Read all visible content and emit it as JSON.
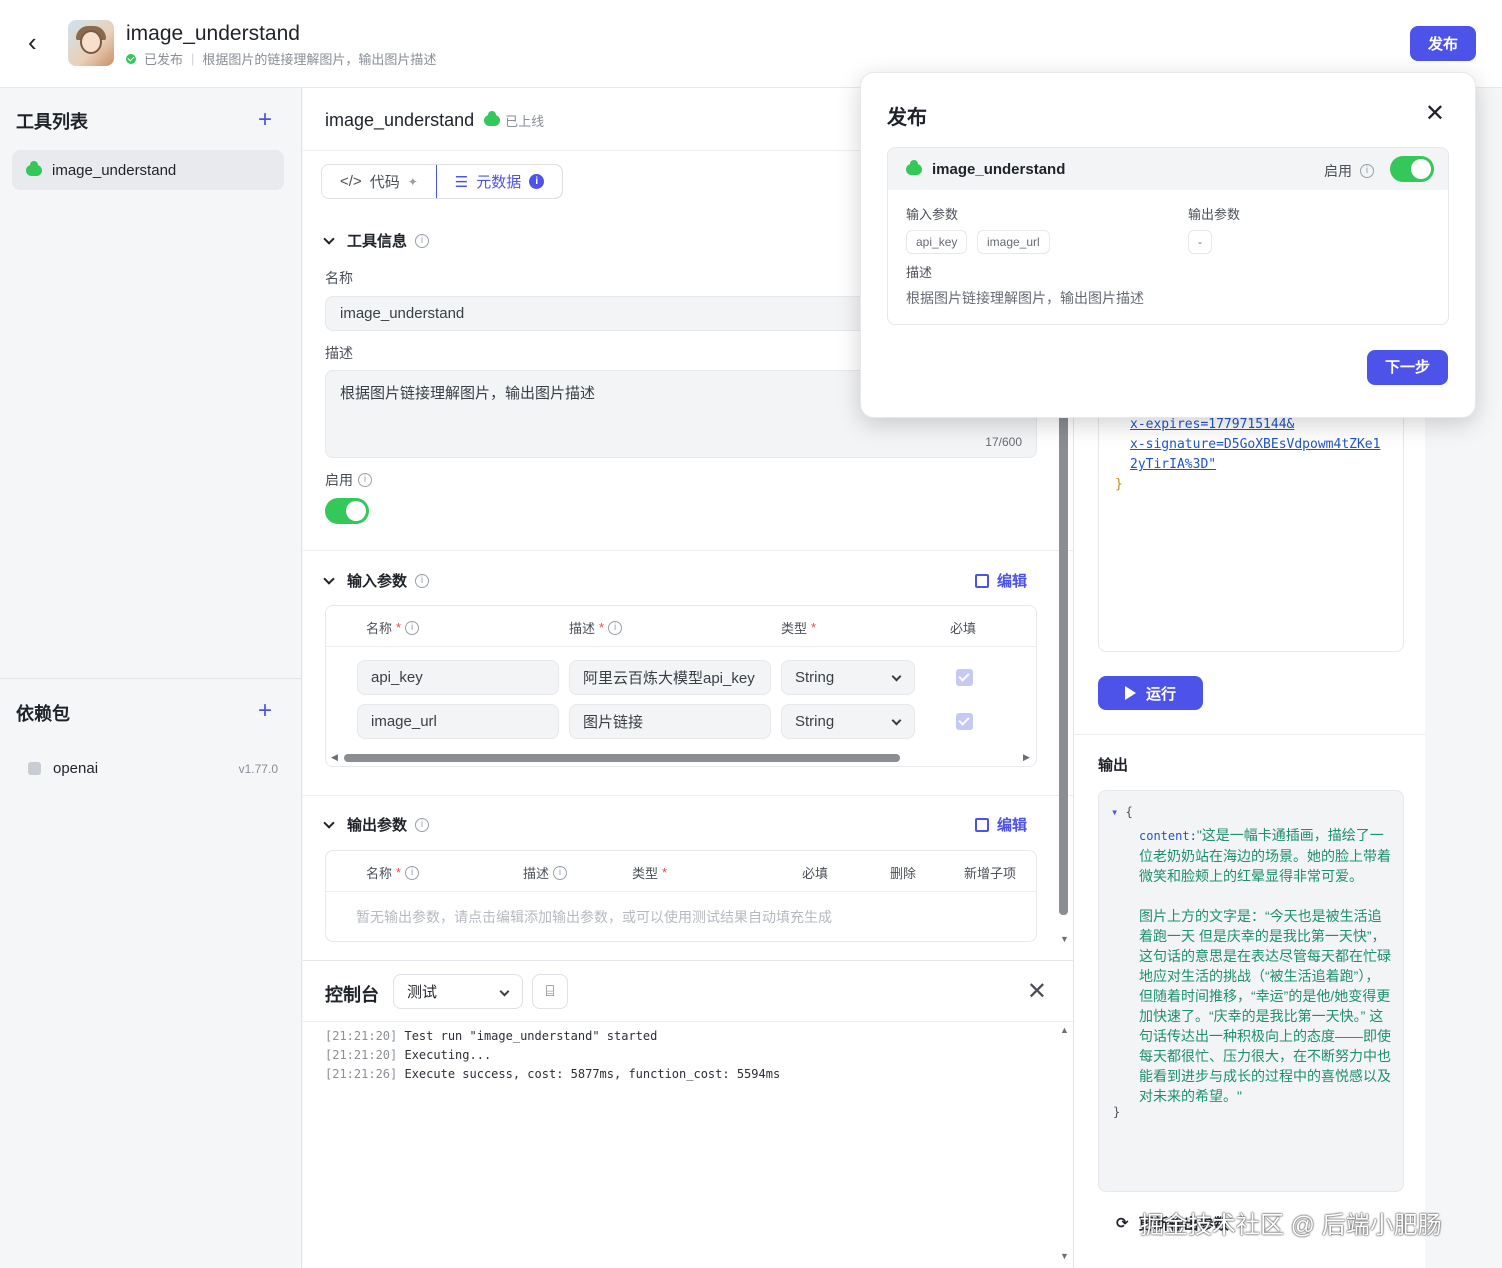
{
  "header": {
    "app_title": "image_understand",
    "status": "已发布",
    "description": "根据图片的链接理解图片，输出图片描述",
    "publish_label": "发布"
  },
  "sidebar": {
    "tools_title": "工具列表",
    "tools": [
      {
        "label": "image_understand"
      }
    ],
    "deps_title": "依赖包",
    "deps": [
      {
        "name": "openai",
        "version": "v1.77.0"
      }
    ]
  },
  "editor": {
    "title": "image_understand",
    "online_label": "已上线",
    "tab_code": "代码",
    "tab_meta": "元数据",
    "tool_info": "工具信息",
    "name_label": "名称",
    "name_value": "image_understand",
    "desc_label": "描述",
    "desc_value": "根据图片链接理解图片，输出图片描述",
    "desc_counter": "17/600",
    "enable_label": "启用",
    "input_params": {
      "title": "输入参数",
      "edit_label": "编辑",
      "columns": {
        "name": "名称",
        "desc": "描述",
        "type": "类型",
        "required": "必填"
      },
      "rows": [
        {
          "name": "api_key",
          "desc": "阿里云百炼大模型api_key",
          "type": "String",
          "required": true
        },
        {
          "name": "image_url",
          "desc": "图片链接",
          "type": "String",
          "required": true
        }
      ]
    },
    "output_params": {
      "title": "输出参数",
      "edit_label": "编辑",
      "columns": {
        "name": "名称",
        "desc": "描述",
        "type": "类型",
        "required": "必填",
        "delete": "删除",
        "add_child": "新增子项"
      },
      "empty_text": "暂无输出参数，请点击编辑添加输出参数，或可以使用测试结果自动填充生成"
    }
  },
  "console": {
    "title": "控制台",
    "mode": "测试",
    "logs": [
      {
        "time": "[21:21:20]",
        "text": "Test run \"image_understand\" started"
      },
      {
        "time": "[21:21:20]",
        "text": "Executing..."
      },
      {
        "time": "[21:21:26]",
        "text": "Execute success, cost: 5877ms, function_cost: 5594ms"
      }
    ]
  },
  "test_panel": {
    "input_lines": [
      "x-expires=1779715144&",
      "x-signature=D5GoXBEsVdpowm4tZKe1",
      "2yTirIA%3D\""
    ],
    "run_label": "运行",
    "output_title": "输出",
    "output_key": "content",
    "output_text": "\"这是一幅卡通插画，描绘了一位老奶奶站在海边的场景。她的脸上带着微笑和脸颊上的红晕显得非常可爱。\n\n图片上方的文字是：“今天也是被生活追着跑一天 但是庆幸的是我比第一天快”，这句话的意思是在表达尽管每天都在忙碌地应对生活的挑战（“被生活追着跑”），但随着时间推移，“幸运”的是他/她变得更加快速了。“庆幸的是我比第一天快。” 这句话传达出一种积极向上的态度——即使每天都很忙、压力很大，在不断努力中也能看到进步与成长的过程中的喜悦感以及对未来的希望。\"",
    "bottom_label": "更新输出参数"
  },
  "modal": {
    "title": "发布",
    "tool_name": "image_understand",
    "enable_label": "启用",
    "input_label": "输入参数",
    "input_tags": [
      "api_key",
      "image_url"
    ],
    "output_label": "输出参数",
    "output_tag": "-",
    "desc_label": "描述",
    "desc_value": "根据图片链接理解图片，输出图片描述",
    "next_label": "下一步"
  },
  "watermark": "掘金技术社区 @ 后端小肥肠"
}
